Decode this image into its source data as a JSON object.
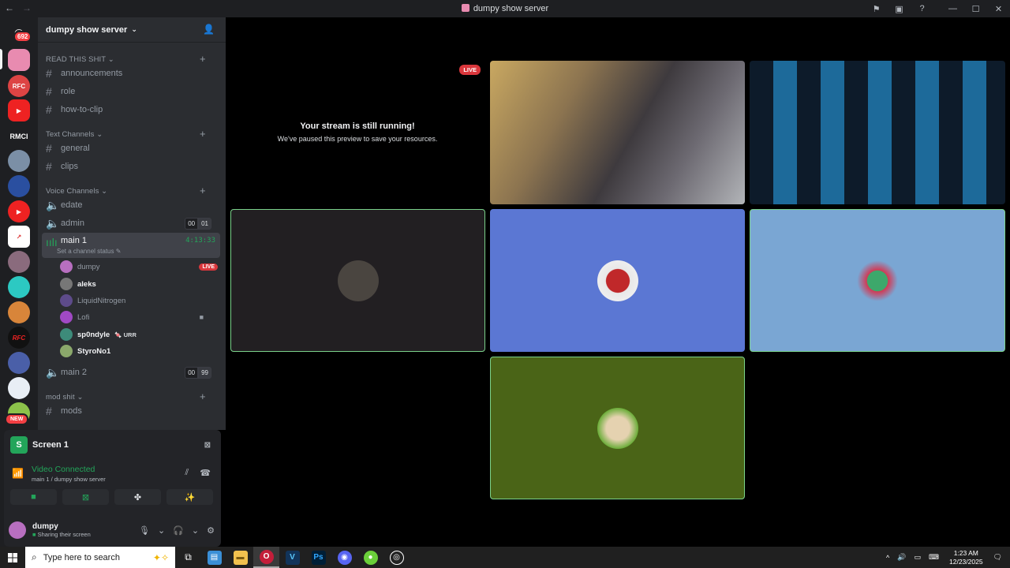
{
  "window": {
    "title": "dumpy show server"
  },
  "rail": {
    "mention_badge": "692",
    "rmci_label": "RMCI",
    "new_badge": "NEW",
    "rfc_label": "RFC"
  },
  "server": {
    "name": "dumpy show server"
  },
  "categories": {
    "read": "READ THIS SHIT",
    "text": "Text Channels",
    "voice": "Voice Channels",
    "mod": "mod shit"
  },
  "channels": {
    "announcements": "announcements",
    "role": "role",
    "how_to_clip": "how-to-clip",
    "general": "general",
    "clips": "clips",
    "edate": "edate",
    "admin": "admin",
    "admin_count_a": "00",
    "admin_count_b": "01",
    "main1": "main 1",
    "main1_timer": "4:13:33",
    "main1_status": "Set a channel status",
    "main2": "main 2",
    "main2_count_a": "00",
    "main2_count_b": "99",
    "mods": "mods"
  },
  "voice_users": [
    {
      "name": "dumpy",
      "live": "LIVE"
    },
    {
      "name": "aleks"
    },
    {
      "name": "LiquidNitrogen"
    },
    {
      "name": "Lofi"
    },
    {
      "name": "sp0ndyle",
      "tag": "URR"
    },
    {
      "name": "StyroNo1"
    }
  ],
  "panel": {
    "screen_title": "Screen 1",
    "status": "Video Connected",
    "location": "main 1 / dumpy show server",
    "username": "dumpy",
    "user_status": "Sharing their screen"
  },
  "stage": {
    "live_badge": "LIVE",
    "paused_title": "Your stream is still running!",
    "paused_text": "We've paused this preview to save your resources."
  },
  "colors": {
    "tile_blue": "#5b77d3",
    "tile_light_blue": "#7aa6d3",
    "tile_olive": "#4a6417",
    "tile_dark": "#221f22",
    "speaking": "#7ad28a",
    "live_red": "#da373c"
  },
  "taskbar": {
    "search_placeholder": "Type here to search",
    "time": "1:23 AM",
    "date": "12/23/2025"
  }
}
